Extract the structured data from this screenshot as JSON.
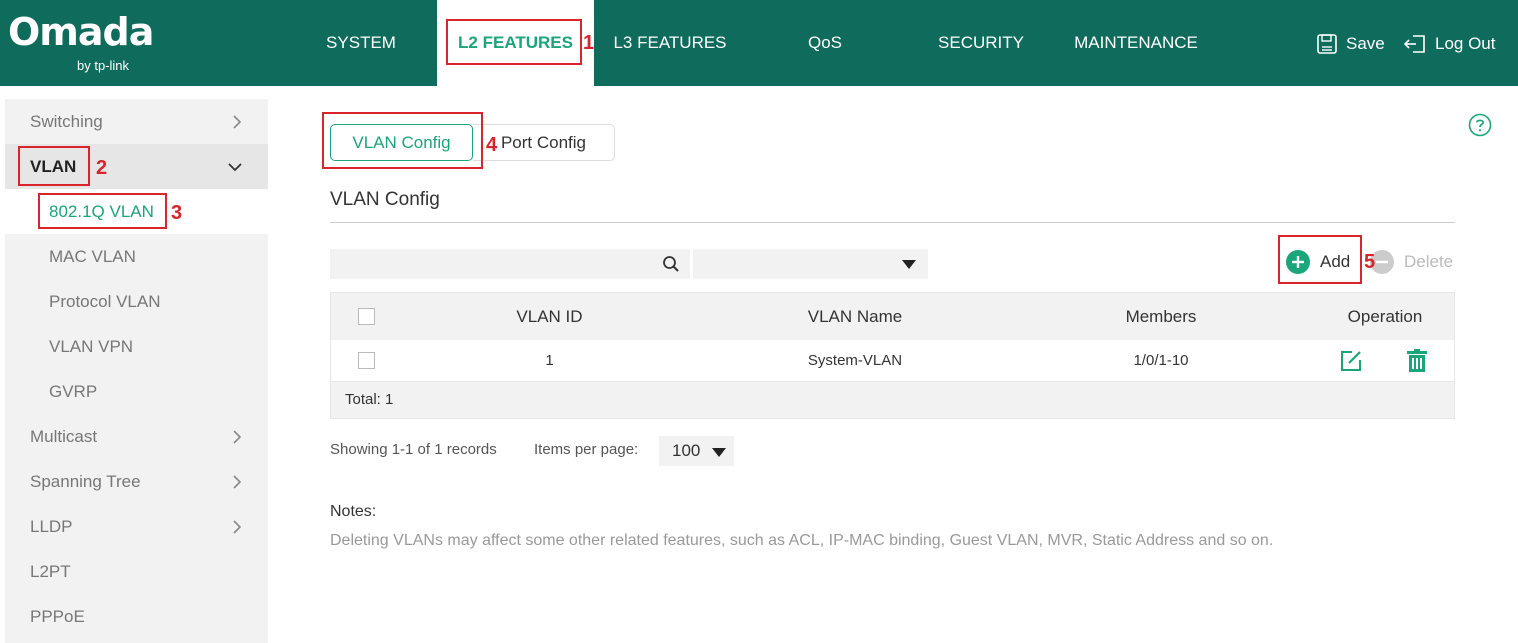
{
  "header": {
    "logo": {
      "brand": "Omada",
      "sub": "by tp-link"
    },
    "nav": [
      {
        "label": "SYSTEM"
      },
      {
        "label": "L2 FEATURES"
      },
      {
        "label": "L3 FEATURES"
      },
      {
        "label": "QoS"
      },
      {
        "label": "SECURITY"
      },
      {
        "label": "MAINTENANCE"
      }
    ],
    "save_label": "Save",
    "logout_label": "Log Out"
  },
  "sidebar": {
    "items": [
      {
        "label": "Switching",
        "icon": "chevron-right-icon"
      },
      {
        "label": "VLAN",
        "icon": "chevron-down-icon"
      },
      {
        "label": "802.1Q VLAN"
      },
      {
        "label": "MAC VLAN"
      },
      {
        "label": "Protocol VLAN"
      },
      {
        "label": "VLAN VPN"
      },
      {
        "label": "GVRP"
      },
      {
        "label": "Multicast",
        "icon": "chevron-right-icon"
      },
      {
        "label": "Spanning Tree",
        "icon": "chevron-right-icon"
      },
      {
        "label": "LLDP",
        "icon": "chevron-right-icon"
      },
      {
        "label": "L2PT"
      },
      {
        "label": "PPPoE"
      }
    ]
  },
  "tabs": [
    {
      "label": "VLAN Config"
    },
    {
      "label": "Port Config"
    }
  ],
  "section_title": "VLAN Config",
  "toolbar": {
    "add_label": "Add",
    "delete_label": "Delete"
  },
  "table": {
    "headers": [
      "VLAN ID",
      "VLAN Name",
      "Members",
      "Operation"
    ],
    "rows": [
      {
        "vlan_id": "1",
        "vlan_name": "System-VLAN",
        "members": "1/0/1-10"
      }
    ],
    "total": "Total: 1"
  },
  "pager": {
    "showing": "Showing 1-1 of 1 records",
    "items_per_page_label": "Items per page:",
    "items_per_page_value": "100"
  },
  "notes": {
    "title": "Notes:",
    "text": "Deleting VLANs may affect some other related features, such as ACL, IP-MAC binding, Guest VLAN, MVR, Static Address and so on."
  },
  "annotations": [
    "1",
    "2",
    "3",
    "4",
    "5"
  ],
  "colors": {
    "header_bg": "#0f6b5c",
    "accent": "#1aa57a",
    "annotation": "#d9242b"
  }
}
